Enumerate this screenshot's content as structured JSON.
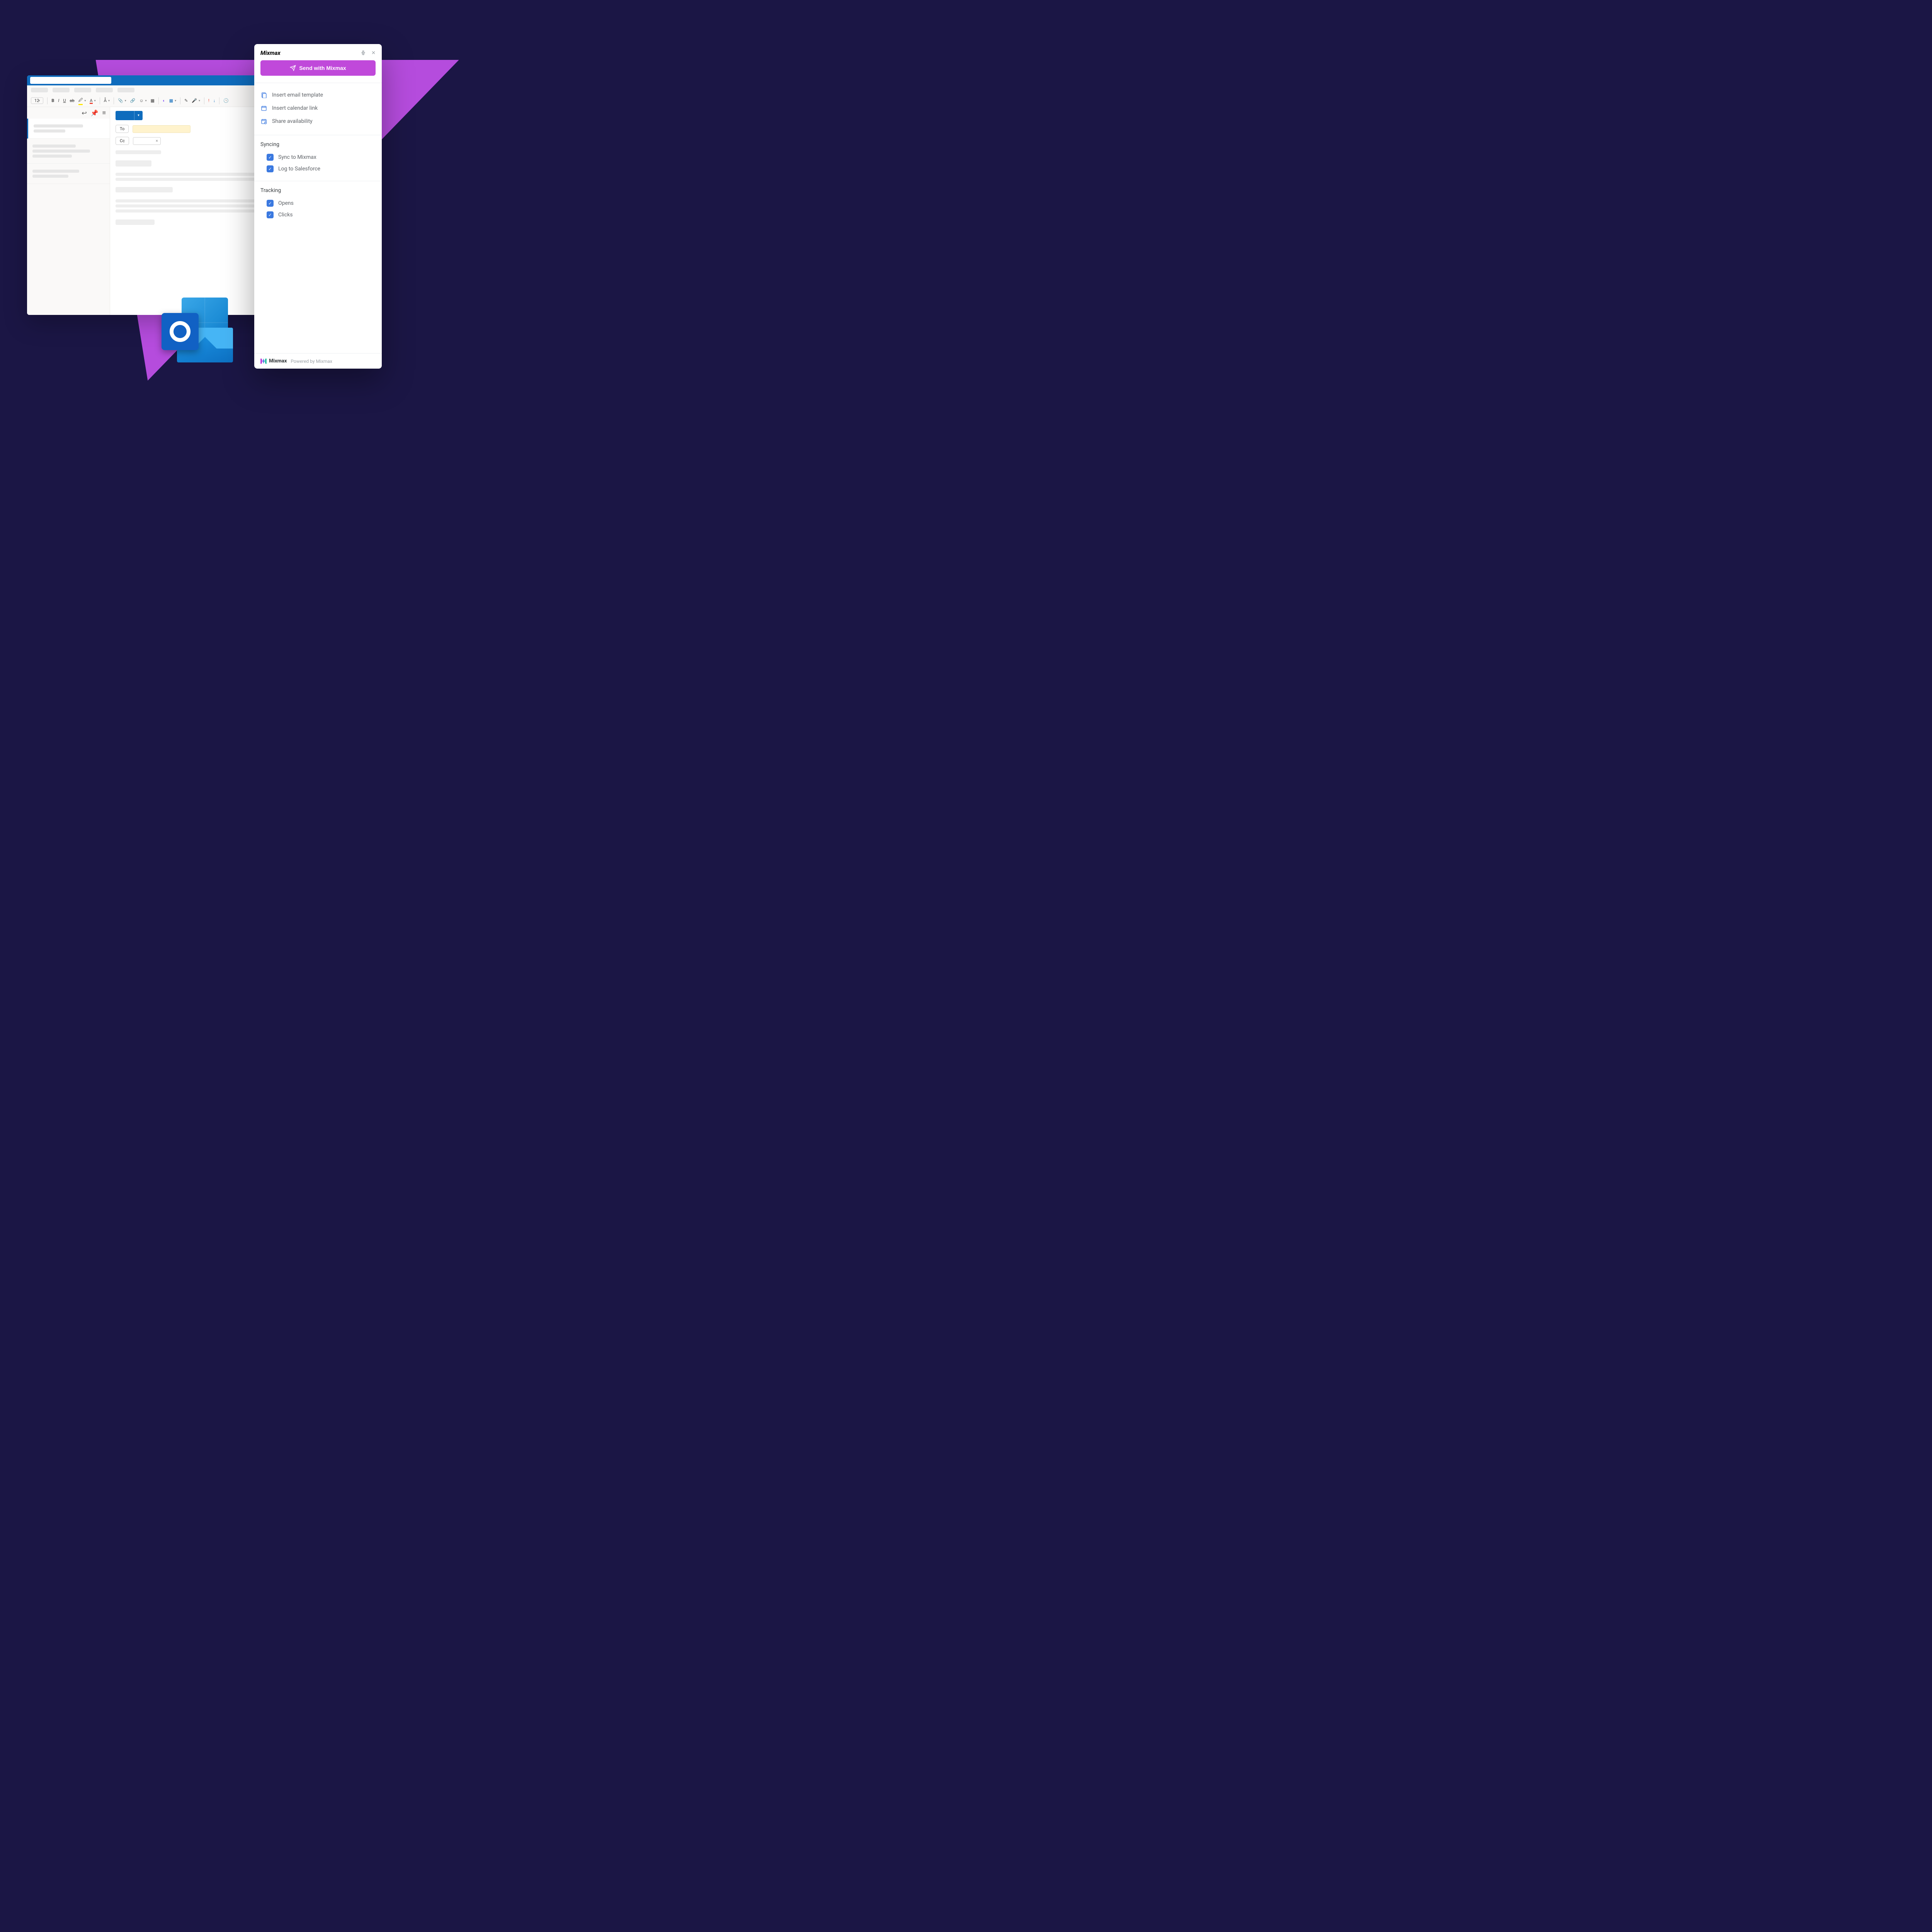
{
  "outlook": {
    "font_size": "12",
    "compose": {
      "to_label": "To",
      "cc_label": "Cc"
    }
  },
  "panel": {
    "title": "Mixmax",
    "send_button": "Send with Mixmax",
    "actions": [
      {
        "label": "Insert email template",
        "icon": "template-icon"
      },
      {
        "label": "Insert calendar link",
        "icon": "calendar-icon"
      },
      {
        "label": "Share availability",
        "icon": "availability-icon"
      }
    ],
    "syncing": {
      "title": "Syncing",
      "items": [
        {
          "label": "Sync to Mixmax",
          "checked": true
        },
        {
          "label": "Log to Salesforce",
          "checked": true
        }
      ]
    },
    "tracking": {
      "title": "Tracking",
      "items": [
        {
          "label": "Opens",
          "checked": true
        },
        {
          "label": "Clicks",
          "checked": true
        }
      ]
    },
    "footer": {
      "brand": "Mixmax",
      "powered": "Powered by Mixmax"
    }
  }
}
